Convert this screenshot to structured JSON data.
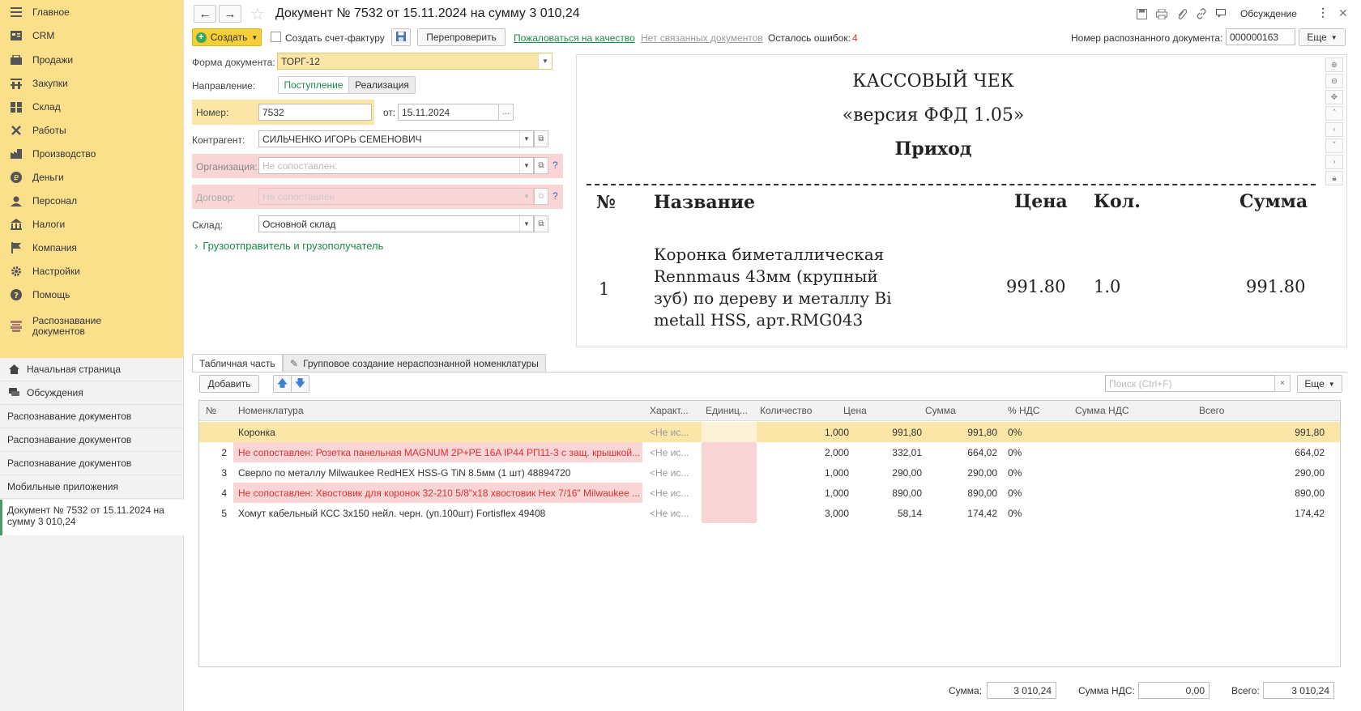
{
  "sidebar": {
    "items": [
      {
        "label": "Главное",
        "icon": "menu-icon"
      },
      {
        "label": "CRM",
        "icon": "crm-icon"
      },
      {
        "label": "Продажи",
        "icon": "sales-icon"
      },
      {
        "label": "Закупки",
        "icon": "purchases-icon"
      },
      {
        "label": "Склад",
        "icon": "warehouse-icon"
      },
      {
        "label": "Работы",
        "icon": "tools-icon"
      },
      {
        "label": "Производство",
        "icon": "production-icon"
      },
      {
        "label": "Деньги",
        "icon": "money-icon"
      },
      {
        "label": "Персонал",
        "icon": "staff-icon"
      },
      {
        "label": "Налоги",
        "icon": "taxes-icon"
      },
      {
        "label": "Компания",
        "icon": "company-icon"
      },
      {
        "label": "Настройки",
        "icon": "gear-icon"
      },
      {
        "label": "Помощь",
        "icon": "help-icon"
      },
      {
        "label": "Распознавание документов",
        "icon": "recognition-icon"
      }
    ],
    "open": [
      {
        "label": "Начальная страница",
        "icon": "home-icon"
      },
      {
        "label": "Обсуждения",
        "icon": "chat-icon"
      },
      {
        "label": "Распознавание документов"
      },
      {
        "label": "Распознавание документов"
      },
      {
        "label": "Распознавание документов"
      },
      {
        "label": "Мобильные приложения"
      }
    ],
    "active": "Документ № 7532 от 15.11.2024 на сумму 3 010,24"
  },
  "header": {
    "title": "Документ № 7532 от 15.11.2024 на сумму 3 010,24",
    "discussion": "Обсуждение"
  },
  "toolbar": {
    "create": "Создать",
    "create_invoice": "Создать счет-фактуру",
    "recheck": "Перепроверить",
    "complain": "Пожаловаться на качество",
    "no_linked": "Нет связанных документов",
    "errors_label": "Осталось ошибок:",
    "errors_count": "4",
    "recognized_label": "Номер распознанного документа:",
    "recognized_value": "000000163",
    "more": "Еще"
  },
  "form": {
    "doc_form_label": "Форма документа:",
    "doc_form_value": "ТОРГ-12",
    "direction_label": "Направление:",
    "direction_in": "Поступление",
    "direction_out": "Реализация",
    "number_label": "Номер:",
    "number_value": "7532",
    "date_label": "от:",
    "date_value": "15.11.2024",
    "counterparty_label": "Контрагент:",
    "counterparty_value": "СИЛЬЧЕНКО ИГОРЬ СЕМЕНОВИЧ",
    "org_label": "Организация:",
    "org_placeholder": "Не сопоставлен:",
    "contract_label": "Договор:",
    "contract_placeholder": "Не сопоставлен",
    "warehouse_label": "Склад:",
    "warehouse_value": "Основной склад",
    "shipper_link": "Грузоотправитель и грузополучатель"
  },
  "receipt": {
    "title": "КАССОВЫЙ ЧЕК",
    "version": "«версия ФФД 1.05»",
    "kind": "Приход",
    "col_no": "№",
    "col_name": "Название",
    "col_price": "Цена",
    "col_qty": "Кол.",
    "col_sum": "Сумма",
    "row_no": "1",
    "row_name_1": "Коронка биметаллическая",
    "row_name_2": "Rennmaus 43мм (крупный",
    "row_name_3": "зуб) по дереву и металлу Bi",
    "row_name_4": "metall HSS, арт.RMG043",
    "row_price": "991.80",
    "row_qty": "1.0",
    "row_sum": "991.80"
  },
  "tabs": {
    "table": "Табличная часть",
    "group": "Групповое создание нераспознанной номенклатуры"
  },
  "table_toolbar": {
    "add": "Добавить",
    "search_placeholder": "Поиск (Ctrl+F)",
    "more": "Еще"
  },
  "table": {
    "headers": [
      "№",
      "Номенклатура",
      "Характ...",
      "Единиц...",
      "Количество",
      "Цена",
      "Сумма",
      "% НДС",
      "Сумма НДС",
      "Всего"
    ],
    "rows": [
      {
        "no": "",
        "name": "Коронка",
        "char": "<Не ис...",
        "qty": "1,000",
        "price": "991,80",
        "sum": "991,80",
        "vat": "0%",
        "vat_sum": "",
        "total": "991,80",
        "state": "selected"
      },
      {
        "no": "2",
        "name": "Не сопоставлен: Розетка панельная MAGNUM 2P+PE 16A IP44 РП11-3 с защ. крышкой...",
        "char": "<Не ис...",
        "qty": "2,000",
        "price": "332,01",
        "sum": "664,02",
        "vat": "0%",
        "vat_sum": "",
        "total": "664,02",
        "state": "error"
      },
      {
        "no": "3",
        "name": "Сверло по металлу Milwaukee RedHEX HSS-G TiN 8.5мм (1 шт) 48894720",
        "char": "<Не ис...",
        "qty": "1,000",
        "price": "290,00",
        "sum": "290,00",
        "vat": "0%",
        "vat_sum": "",
        "total": "290,00",
        "state": "normal"
      },
      {
        "no": "4",
        "name": "Не сопоставлен: Хвостовик для коронок 32-210 5/8\"x18 хвостовик Hex 7/16\" Milwaukee ...",
        "char": "<Не ис...",
        "qty": "1,000",
        "price": "890,00",
        "sum": "890,00",
        "vat": "0%",
        "vat_sum": "",
        "total": "890,00",
        "state": "error"
      },
      {
        "no": "5",
        "name": "Хомут кабельный КСС 3х150 нейл. черн. (уп.100шт) Fortisflex 49408",
        "char": "<Не ис...",
        "qty": "3,000",
        "price": "58,14",
        "sum": "174,42",
        "vat": "0%",
        "vat_sum": "",
        "total": "174,42",
        "state": "normal"
      }
    ]
  },
  "footer": {
    "sum_label": "Сумма:",
    "sum_value": "3 010,24",
    "vat_label": "Сумма НДС:",
    "vat_value": "0,00",
    "total_label": "Всего:",
    "total_value": "3 010,24"
  },
  "colors": {
    "sidebar_bg": "#fbe08c",
    "error_bg": "#f9d5d5",
    "error_text": "#e03030",
    "link_green": "#1a8a4a",
    "create_btn": "#f5cf35"
  }
}
